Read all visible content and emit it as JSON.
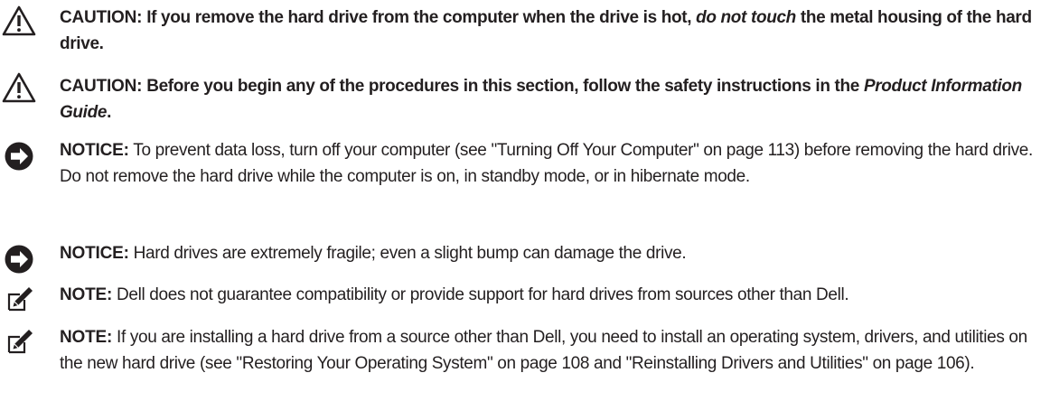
{
  "notices": [
    {
      "type": "caution",
      "icon": "caution-triangle-icon",
      "label": "CAUTION:",
      "text_before": " If you remove the hard drive from the computer when the drive is hot, ",
      "emphasis": "do not touch",
      "text_after": " the metal housing of the hard drive."
    },
    {
      "type": "caution",
      "icon": "caution-triangle-icon",
      "label": "CAUTION:",
      "text_before": " Before you begin any of the procedures in this section, follow the safety instructions in the ",
      "emphasis": "Product Information Guide",
      "text_after": "."
    },
    {
      "type": "notice",
      "icon": "notice-arrow-icon",
      "label": "NOTICE:",
      "text": " To prevent data loss, turn off your computer (see \"Turning Off Your Computer\" on page 113) before removing the hard drive. Do not remove the hard drive while the computer is on, in standby mode, or in hibernate mode."
    },
    {
      "type": "notice",
      "icon": "notice-arrow-icon",
      "label": "NOTICE:",
      "text": " Hard drives are extremely fragile; even a slight bump can damage the drive."
    },
    {
      "type": "note",
      "icon": "note-pencil-icon",
      "label": "NOTE:",
      "text": " Dell does not guarantee compatibility or provide support for hard drives from sources other than Dell."
    },
    {
      "type": "note",
      "icon": "note-pencil-icon",
      "label": "NOTE:",
      "text": " If you are installing a hard drive from a source other than Dell, you need to install an operating system, drivers, and utilities on the new hard drive (see \"Restoring Your Operating System\" on page 108 and \"Reinstalling Drivers and Utilities\" on page 106)."
    }
  ]
}
